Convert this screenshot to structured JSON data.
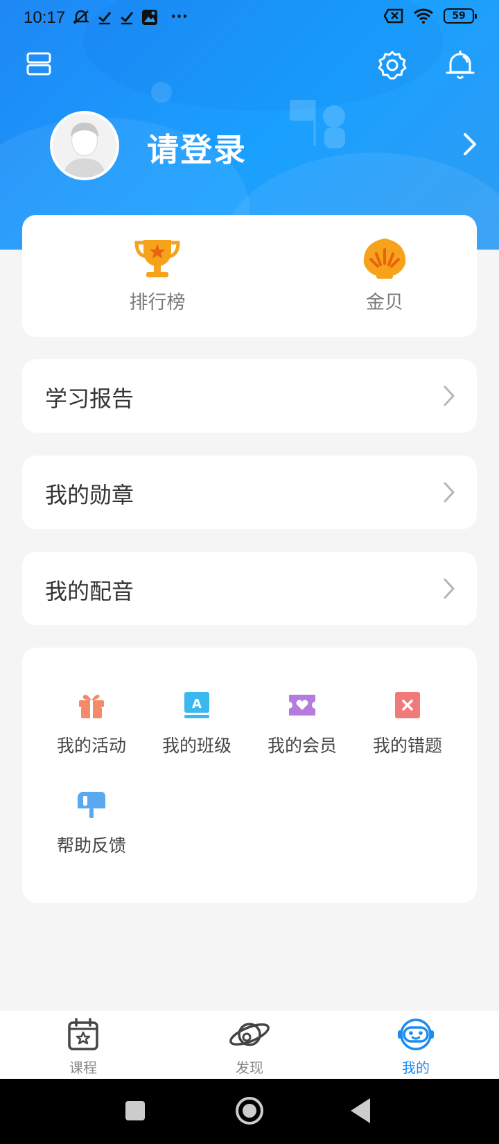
{
  "status_bar": {
    "time": "10:17",
    "dots": "···",
    "battery_level": "59",
    "icons_left": [
      "mute-icon",
      "check-icon",
      "check-icon",
      "gallery-icon"
    ],
    "icons_right": [
      "no-sim-icon",
      "wifi-icon",
      "battery-icon"
    ]
  },
  "header": {
    "login_label": "请登录",
    "icons": [
      "menu-icon",
      "settings-icon",
      "bell-icon",
      "avatar",
      "chevron-right-icon"
    ]
  },
  "stats": [
    {
      "label": "排行榜",
      "icon": "trophy-icon"
    },
    {
      "label": "金贝",
      "icon": "shell-icon"
    }
  ],
  "rows": [
    {
      "label": "学习报告"
    },
    {
      "label": "我的勋章"
    },
    {
      "label": "我的配音"
    }
  ],
  "grid": [
    {
      "label": "我的活动",
      "icon": "gift-icon",
      "color": "#f58a6a"
    },
    {
      "label": "我的班级",
      "icon": "class-book-icon",
      "color": "#3cb8f0"
    },
    {
      "label": "我的会员",
      "icon": "vip-ticket-icon",
      "color": "#b57ce0"
    },
    {
      "label": "我的错题",
      "icon": "wrong-book-icon",
      "color": "#f07a7a"
    },
    {
      "label": "帮助反馈",
      "icon": "mailbox-icon",
      "color": "#5aa8f0"
    }
  ],
  "tabbar": {
    "tabs": [
      {
        "label": "课程",
        "icon": "calendar-star-icon",
        "active": false
      },
      {
        "label": "发现",
        "icon": "planet-icon",
        "active": false
      },
      {
        "label": "我的",
        "icon": "robot-face-icon",
        "active": true
      }
    ]
  },
  "colors": {
    "header_blue": "#1aa0ff",
    "accent": "#1a8cf0",
    "trophy": "#f7a21b",
    "shell": "#f7a21b"
  }
}
